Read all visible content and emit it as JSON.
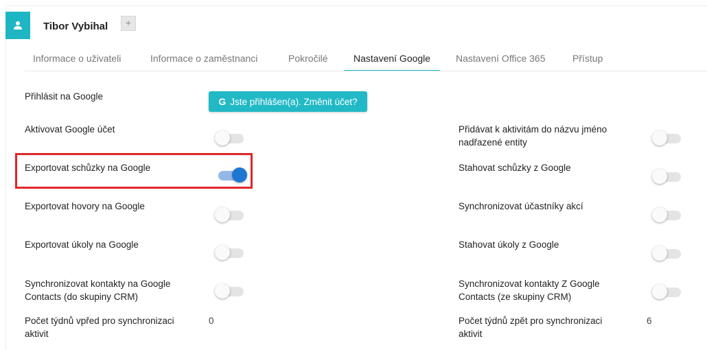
{
  "header": {
    "user_icon": "user-icon",
    "user_name": "Tibor Vybihal",
    "add_label": "+"
  },
  "tabs": [
    {
      "label": "Informace o uživateli",
      "active": false
    },
    {
      "label": "Informace o zaměstnanci",
      "active": false
    },
    {
      "label": "Pokročilé",
      "active": false
    },
    {
      "label": "Nastavení Google",
      "active": true
    },
    {
      "label": "Nastavení Office 365",
      "active": false
    },
    {
      "label": "Přístup",
      "active": false
    }
  ],
  "settings": {
    "login": {
      "label": "Přihlásit na Google",
      "button_icon": "G",
      "button_label": "Jste přihlášen(a). Změnit účet?"
    },
    "left": [
      {
        "label": "Aktivovat Google účet",
        "on": false
      },
      {
        "label": "Exportovat schůzky na Google",
        "on": true
      },
      {
        "label": "Exportovat hovory na Google",
        "on": false
      },
      {
        "label": "Exportovat úkoly na Google",
        "on": false
      },
      {
        "label_line1": "Synchronizovat kontakty na Google",
        "label_line2": "Contacts (do skupiny CRM)",
        "on": false
      },
      {
        "label_line1": "Počet týdnů vpřed pro synchronizaci",
        "label_line2": "aktivit",
        "value": "0"
      }
    ],
    "right": [
      {
        "label_line1": "Přidávat k aktivitám do názvu jméno",
        "label_line2": "nadřazené entity",
        "on": false
      },
      {
        "label": "Stahovat schůzky z Google",
        "on": false
      },
      {
        "label": "Synchronizovat účastníky akcí",
        "on": false
      },
      {
        "label": "Stahovat úkoly z Google",
        "on": false
      },
      {
        "label_line1": "Synchronizovat kontakty Z Google",
        "label_line2": "Contacts (ze skupiny CRM)",
        "on": false
      },
      {
        "label_line1": "Počet týdnů zpět pro synchronizaci",
        "label_line2": "aktivit",
        "value": "6"
      }
    ]
  },
  "colors": {
    "accent": "#1eb6c4",
    "toggle_on": "#1f76d2",
    "highlight": "#e0262a"
  }
}
